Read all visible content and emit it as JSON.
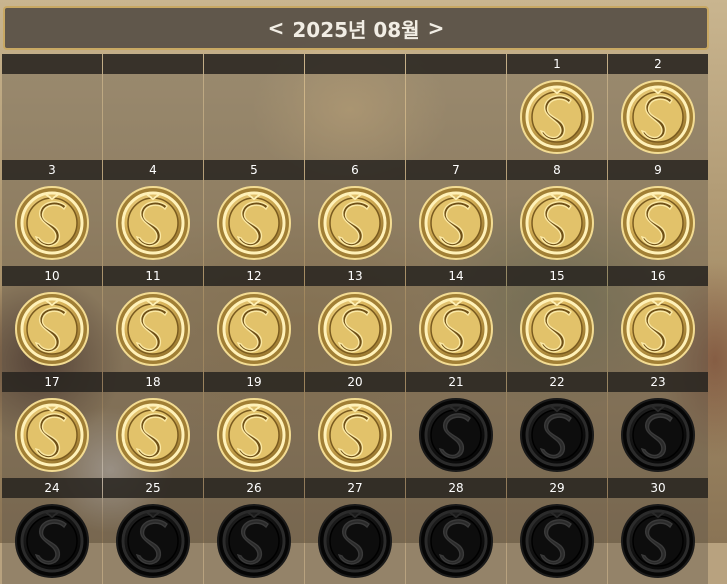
{
  "header": {
    "prev_label": "<",
    "title": "2025년 08월",
    "next_label": ">"
  },
  "calendar": {
    "cells": [
      {
        "day": "",
        "status": "none"
      },
      {
        "day": "",
        "status": "none"
      },
      {
        "day": "",
        "status": "none"
      },
      {
        "day": "",
        "status": "none"
      },
      {
        "day": "",
        "status": "none"
      },
      {
        "day": "1",
        "status": "checked"
      },
      {
        "day": "2",
        "status": "checked"
      },
      {
        "day": "3",
        "status": "checked"
      },
      {
        "day": "4",
        "status": "checked"
      },
      {
        "day": "5",
        "status": "checked"
      },
      {
        "day": "6",
        "status": "checked"
      },
      {
        "day": "7",
        "status": "checked"
      },
      {
        "day": "8",
        "status": "checked"
      },
      {
        "day": "9",
        "status": "checked"
      },
      {
        "day": "10",
        "status": "checked"
      },
      {
        "day": "11",
        "status": "checked"
      },
      {
        "day": "12",
        "status": "checked"
      },
      {
        "day": "13",
        "status": "checked"
      },
      {
        "day": "14",
        "status": "checked"
      },
      {
        "day": "15",
        "status": "checked"
      },
      {
        "day": "16",
        "status": "checked"
      },
      {
        "day": "17",
        "status": "checked"
      },
      {
        "day": "18",
        "status": "checked"
      },
      {
        "day": "19",
        "status": "checked"
      },
      {
        "day": "20",
        "status": "checked"
      },
      {
        "day": "21",
        "status": "unchecked"
      },
      {
        "day": "22",
        "status": "unchecked"
      },
      {
        "day": "23",
        "status": "unchecked"
      },
      {
        "day": "24",
        "status": "unchecked"
      },
      {
        "day": "25",
        "status": "unchecked"
      },
      {
        "day": "26",
        "status": "unchecked"
      },
      {
        "day": "27",
        "status": "unchecked"
      },
      {
        "day": "28",
        "status": "unchecked"
      },
      {
        "day": "29",
        "status": "unchecked"
      },
      {
        "day": "30",
        "status": "unchecked"
      }
    ]
  },
  "icons": {
    "checked": "gold-s-coin-icon",
    "unchecked": "black-s-coin-icon"
  },
  "colors": {
    "header_border": "#c8a863",
    "coin_gold": "#e2c26a",
    "coin_dark": "#101010"
  }
}
